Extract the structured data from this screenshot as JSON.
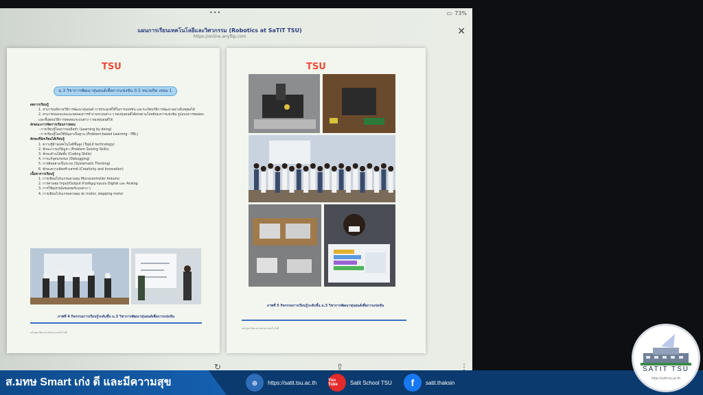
{
  "status": {
    "dots": "•••",
    "battery": "73%"
  },
  "doc": {
    "title": "แผนการเรียนเทคโนโลยีและวิศวกรรม (Robotics at SaTiT TSU)",
    "url": "https://online.anyflip.com",
    "close": "✕"
  },
  "left_page": {
    "logo": "TSU",
    "banner": "ม.3 วิชาการพัฒนาหุ่นยนต์เพื่อการแข่งขัน 0.5 หน่วยกิต เทอม 1",
    "sections": [
      {
        "head": "ผลการเรียนรู้",
        "items": [
          "1. สามารถอธิบายวิธีการพัฒนาหุ่นยนต์ การประยุกต์ใช้ในการแข่งขัน และระเบียบวิธีการพัฒนาอย่างมีเหตุผลได้",
          "2. สามารถออกแบบและทดลองการทำงานระบบต่าง ๆ ของหุ่นยนต์ได้ตรงตามโจทย์ของการแข่งขัน รูปแบบการทดสอบ และขั้นตอนวิธีการทดสอบระบบต่าง ๆ ของหุ่นยนต์ได้"
        ]
      },
      {
        "head": "ลักษณะการจัดการเรียนการสอน",
        "items": [
          "- การเรียนรู้โดยการลงมือทำ (Learning by doing)",
          "- การเรียนรู้โดยใช้ปัญหาเป็นฐาน (Problem-based Learning : PBL)"
        ]
      },
      {
        "head": "ทักษะที่นักเรียนได้เรียนรู้",
        "items": [
          "1. ความรู้ด้านเทคโนโลยีชั้นสูง (TopLit technology)",
          "2. ทักษะการแก้ปัญหา (Problem Solving Skills)",
          "3. ทักษะด้านโค้ดดิ้ง (Coding Skills)",
          "4. การแก้จุดบกพร่อง (Debugging)",
          "5. การคิดอย่างเป็นระบบ (Systematic Thinking)",
          "6. ทักษะความคิดสร้างสรรค์ (Creativity and Innovation)"
        ]
      },
      {
        "head": "เนื้อหาการเรียนรู้",
        "items": [
          "1. การเขียนโปรแกรมควบคุม Microcontroller Arduino",
          "2. การควบคุม Input/Output ด้วยสัญญาณแบบ Digital และ Analog",
          "3. การใช้อุปกรณ์เซนเซอร์แบบต่าง ๆ",
          "4. การเขียนโปรแกรมควบคุม dc motor, stepping motor"
        ]
      }
    ],
    "caption": "ภาพที่ 4 กิจกรรมการเรียนรู้ระดับชั้น ม.3 วิชาการพัฒนาหุ่นยนต์เพื่อการแข่งขัน",
    "footer": "หลักสูตรวิทยาศาสตร์และเทคโนโลยี"
  },
  "right_page": {
    "logo": "TSU",
    "caption": "ภาพที่ 5 กิจกรรมการเรียนรู้ระดับชั้น ม.3 วิชาการพัฒนาหุ่นยนต์เพื่อการแข่งขัน",
    "footer": "หลักสูตรวิทยาศาสตร์และเทคโนโลยี"
  },
  "controls": {
    "rotate": "↻",
    "share": "⇧",
    "more": "⋮"
  },
  "bottom": {
    "slogan": "ส.มทษ Smart เก่ง ดี และมีความสุข",
    "website": "https://satit.tsu.ac.th",
    "youtube_label": "You Tube",
    "youtube": "Satit School TSU",
    "facebook_label": "f",
    "facebook": "satit.thaksin"
  },
  "badge": {
    "name": "SATIT TSU",
    "url": "https://satit.tsu.ac.th"
  },
  "colors": {
    "accent": "#1560b0",
    "youtube": "#e32b2b",
    "facebook": "#1877f2"
  }
}
